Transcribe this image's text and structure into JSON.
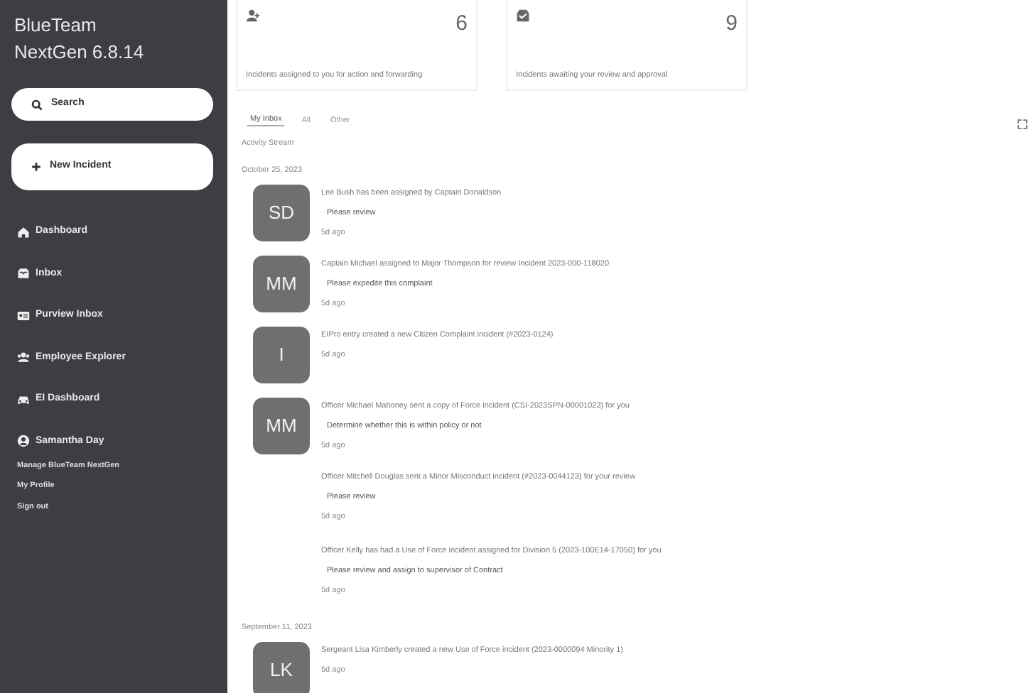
{
  "sidebar": {
    "brand": "BlueTeam",
    "version": "NextGen 6.8.14",
    "search_button": "Search",
    "new_button": "New Incident",
    "nav": [
      {
        "label": "Dashboard",
        "kind": "home"
      },
      {
        "label": "Inbox",
        "kind": "inbox"
      },
      {
        "label": "Purview Inbox",
        "kind": "card"
      },
      {
        "label": "Employee Explorer",
        "kind": "users"
      },
      {
        "label": "EI Dashboard",
        "kind": "car"
      }
    ],
    "user": {
      "name": "Samantha Day",
      "links": [
        "Manage BlueTeam NextGen",
        "My Profile",
        "Sign out"
      ]
    }
  },
  "cards": [
    {
      "kind": "assigned",
      "count": "6",
      "caption": "Incidents assigned to you for action and forwarding"
    },
    {
      "kind": "review",
      "count": "9",
      "caption": "Incidents awaiting your review and approval"
    }
  ],
  "tabs": [
    {
      "label": "My Inbox",
      "selected": true
    },
    {
      "label": "All",
      "selected": false
    },
    {
      "label": "Other",
      "selected": false
    }
  ],
  "stream": {
    "title": "Activity Stream",
    "groups": [
      {
        "date": "October 25, 2023",
        "entries": [
          {
            "avatar": "SD",
            "text": "Lee Bush has been assigned by Captain Donaldson",
            "note": "Please review",
            "time": "5d ago"
          },
          {
            "avatar": "MM",
            "text": "Captain Michael assigned to Major Thompson for review Incident 2023-000-118020",
            "note": "Please expedite this complaint",
            "time": "5d ago"
          },
          {
            "avatar": "I",
            "text": "EIPro entry created a new Citizen Complaint incident (#2023-0124)",
            "time": "5d ago"
          },
          {
            "avatar": "MM",
            "text": "Officer Michael Mahoney sent a copy of Force incident (CSI-2023SPN-00001023) for you",
            "note": "Determine whether this is within policy or not",
            "time": "5d ago"
          },
          {
            "text": "Officer Mitchell Douglas sent a Minor Misconduct incident (#2023-0044123) for your review",
            "note": "Please review",
            "time": "5d ago"
          },
          {
            "text": "Officer Kelly has had a Use of Force incident assigned for Division 5 (2023-100E14-17050) for you",
            "note": "Please review and assign to supervisor of Contract",
            "time": "5d ago"
          }
        ]
      },
      {
        "date": "September 11, 2023",
        "entries": [
          {
            "avatar": "LK",
            "text": "Sergeant Lisa Kimberly created a new Use of Force incident (2023-0000094 Minority 1)",
            "time": "5d ago"
          }
        ]
      }
    ]
  }
}
